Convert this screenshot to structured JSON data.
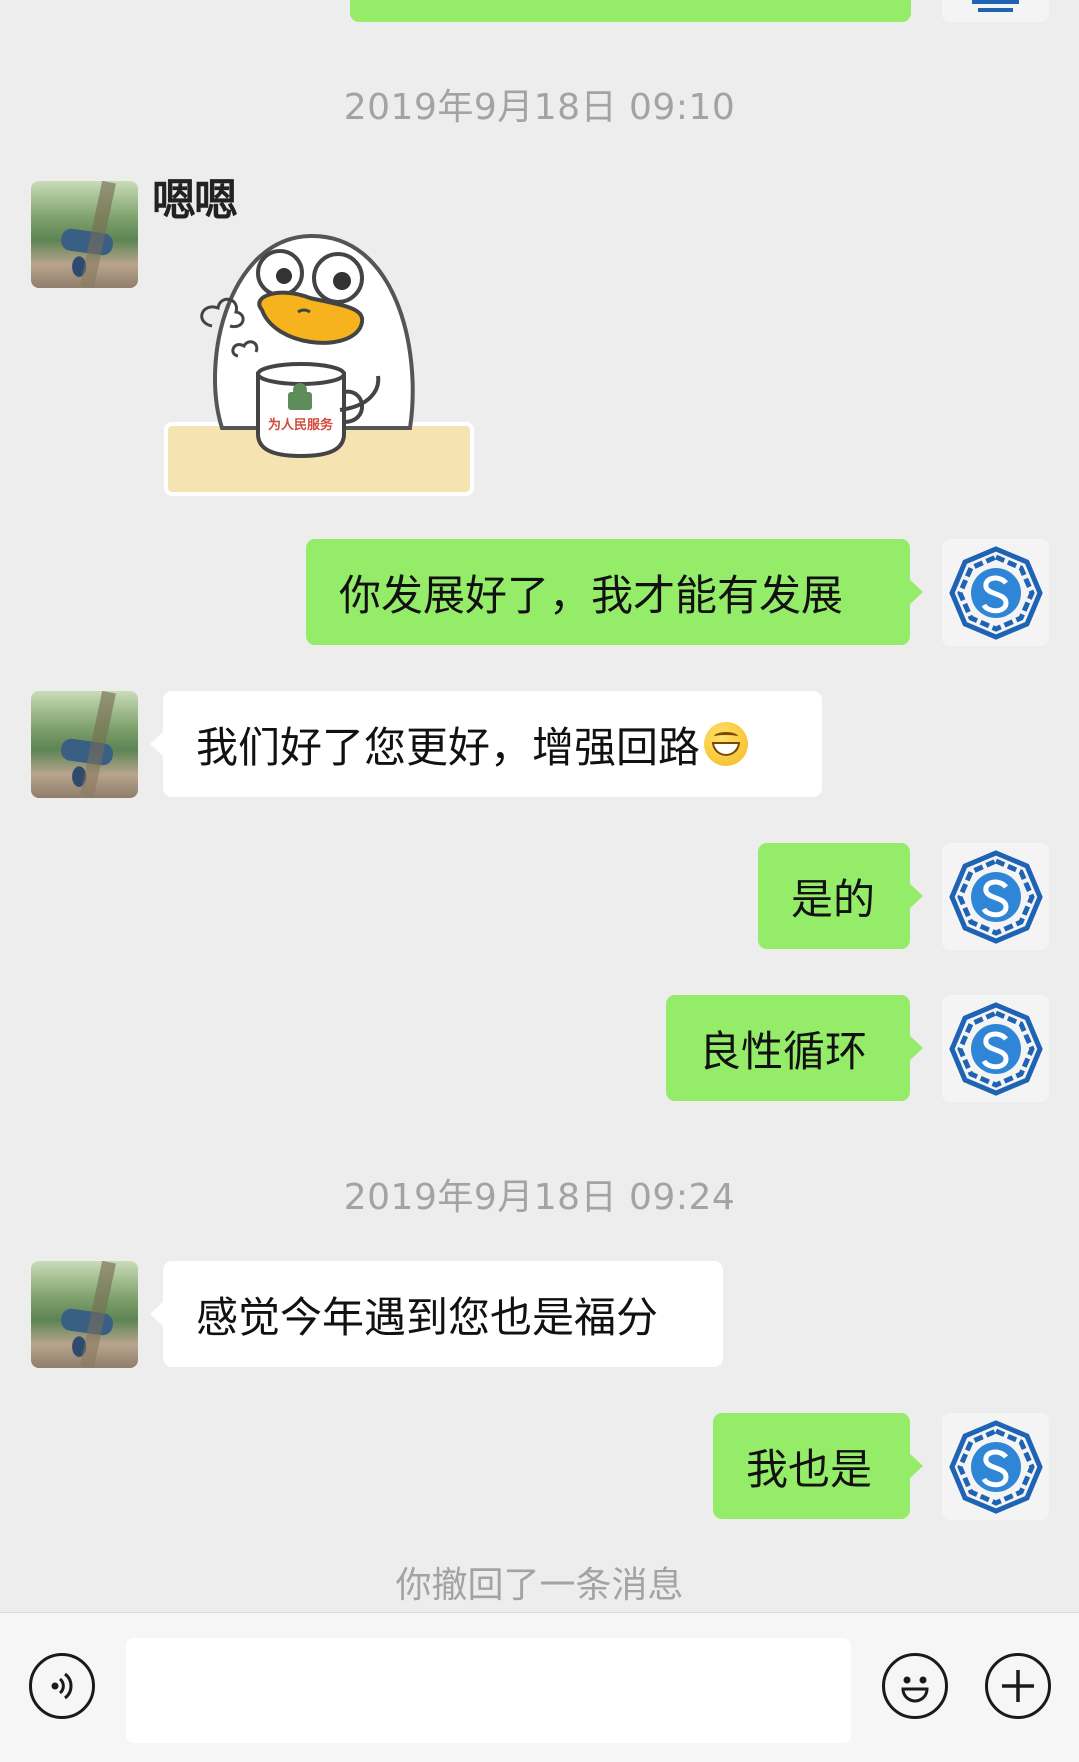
{
  "timestamps": [
    "2019年9月18日 09:10",
    "2019年9月18日 09:24"
  ],
  "sticker": {
    "label": "嗯嗯",
    "mug_text": "为人民服务"
  },
  "messages": [
    {
      "side": "me",
      "text": "你发展好了，我才能有发展"
    },
    {
      "side": "her",
      "text": "我们好了您更好，增强回路",
      "emoji": "grin"
    },
    {
      "side": "me",
      "text": "是的"
    },
    {
      "side": "me",
      "text": "良性循环"
    },
    {
      "side": "her",
      "text": "感觉今年遇到您也是福分"
    },
    {
      "side": "me",
      "text": "我也是"
    }
  ],
  "system_notice": "你撤回了一条消息",
  "input_bar": {
    "voice_icon": "voice-icon",
    "emoji_icon": "emoji-icon",
    "plus_icon": "plus-icon",
    "text_value": ""
  },
  "colors": {
    "background": "#ededed",
    "my_bubble": "#95ec69",
    "her_bubble": "#ffffff",
    "timestamp": "#a3a3a3",
    "logo_blue": "#1f63b4"
  }
}
